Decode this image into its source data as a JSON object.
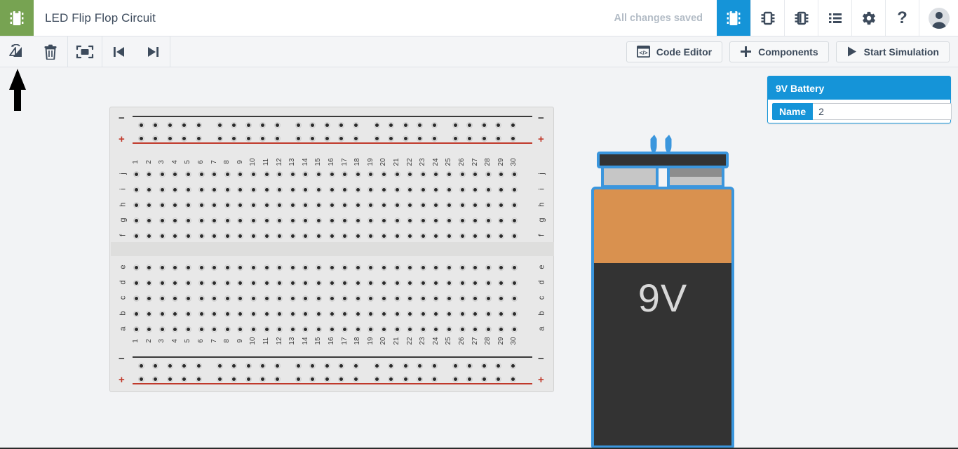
{
  "app": {
    "logo_icon": "chip-icon",
    "document_title": "LED Flip Flop Circuit",
    "save_status": "All changes saved"
  },
  "colors": {
    "brand_green": "#77a352",
    "accent_blue": "#1594d8",
    "selection_blue": "#3b96dd",
    "toolbar_text": "#3d4b5c",
    "canvas_bg": "#f2f3f5",
    "battery_orange": "#d9914f",
    "battery_body": "#333333",
    "rail_plus": "#c0392b",
    "rail_minus": "#3a3a3a"
  },
  "topbar": {
    "tabs": [
      {
        "name": "breadboard-view",
        "icon": "chip-vertical-icon",
        "active": true
      },
      {
        "name": "schematic-view",
        "icon": "ic-horizontal-icon",
        "active": false
      },
      {
        "name": "pcb-view",
        "icon": "ic-split-icon",
        "active": false
      },
      {
        "name": "list-view",
        "icon": "list-icon",
        "active": false
      }
    ],
    "settings_icon": "gear-icon",
    "help_icon": "question-mark-icon",
    "avatar_icon": "user-avatar-icon"
  },
  "toolbar": {
    "left_tools": [
      {
        "name": "flip-button",
        "icon": "flip-icon"
      },
      {
        "name": "delete-button",
        "icon": "trash-icon"
      },
      {
        "name": "fit-to-screen-button",
        "icon": "fit-screen-icon"
      },
      {
        "name": "step-back-button",
        "icon": "skip-previous-icon"
      },
      {
        "name": "step-forward-button",
        "icon": "skip-next-icon"
      }
    ],
    "code_editor_label": "Code Editor",
    "code_editor_icon": "code-window-icon",
    "components_label": "Components",
    "components_icon": "plus-icon",
    "start_simulation_label": "Start Simulation",
    "start_simulation_icon": "play-icon"
  },
  "canvas": {
    "annotation": {
      "name": "pointer-arrow-annotation",
      "direction": "up"
    }
  },
  "breadboard": {
    "name": "breadboard",
    "columns": [
      1,
      2,
      3,
      4,
      5,
      6,
      7,
      8,
      9,
      10,
      11,
      12,
      13,
      14,
      15,
      16,
      17,
      18,
      19,
      20,
      21,
      22,
      23,
      24,
      25,
      26,
      27,
      28,
      29,
      30
    ],
    "top_rows": [
      "j",
      "i",
      "h",
      "g",
      "f"
    ],
    "bottom_rows": [
      "e",
      "d",
      "c",
      "b",
      "a"
    ],
    "rail_minus_symbol": "−",
    "rail_plus_symbol": "+",
    "rail_count": 2
  },
  "battery": {
    "name": "9v-battery-component",
    "face_label": "9V",
    "selected": true,
    "pin_count": 2
  },
  "properties_panel": {
    "title": "9V Battery",
    "fields": [
      {
        "label": "Name",
        "value": "2"
      }
    ]
  }
}
